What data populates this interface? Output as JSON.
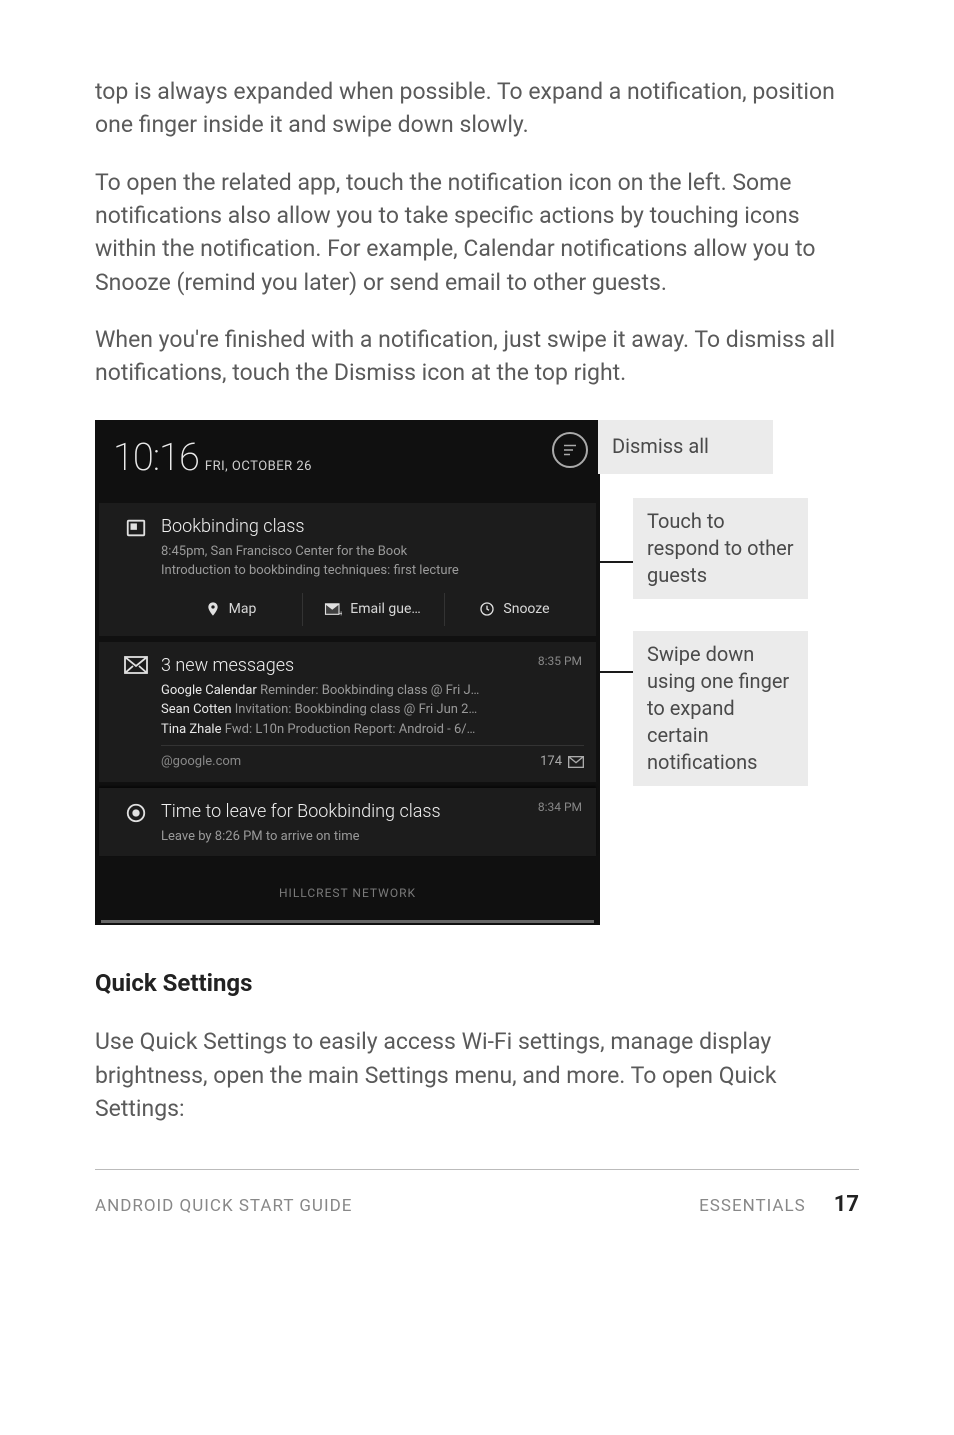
{
  "paragraphs": {
    "p1": "top is always expanded when possible. To expand a notification, position one finger inside it and swipe down slowly.",
    "p2": "To open the related app, touch the notification icon on the left. Some notifications also allow you to take specific actions by touching icons within the notification. For example, Calendar notifications allow you to Snooze (remind you later) or send email to other guests.",
    "p3": "When you're finished with a notification, just swipe it away. To dismiss all notifications, touch the Dismiss icon at the top right.",
    "p4": "Use Quick Settings to easily access Wi-Fi settings, manage display brightness, open the main Settings menu, and more. To open Quick Settings:"
  },
  "heading": "Quick Settings",
  "shade": {
    "time": "10:16",
    "date": "FRI, OCTOBER 26",
    "calendar": {
      "title": "Bookbinding class",
      "line1": "8:45pm, San Francisco Center for the Book",
      "line2": "Introduction to bookbinding techniques: first lecture",
      "actions": {
        "map": "Map",
        "email": "Email gue…",
        "snooze": "Snooze"
      }
    },
    "email": {
      "title": "3 new messages",
      "time": "8:35 PM",
      "m1_sender": "Google Calendar",
      "m1_subject": "  Reminder: Bookbinding class @ Fri J…",
      "m2_sender": "Sean Cotten",
      "m2_subject": "  Invitation: Bookbinding class @ Fri Jun 2…",
      "m3_sender": "Tina Zhale",
      "m3_subject": "  Fwd: L10n Production Report: Android - 6/…",
      "account": "@google.com",
      "count": "174"
    },
    "now": {
      "title": "Time to leave for Bookbinding class",
      "time": "8:34 PM",
      "line": "Leave by 8:26 PM to arrive on time"
    },
    "network": "HILLCREST NETWORK"
  },
  "annotations": {
    "dismiss": "Dismiss all",
    "touch": "Touch to respond to other guests",
    "swipe": "Swipe down using one finger to expand certain notifications"
  },
  "footer": {
    "left": "ANDROID QUICK START GUIDE",
    "section": "ESSENTIALS",
    "page": "17"
  }
}
